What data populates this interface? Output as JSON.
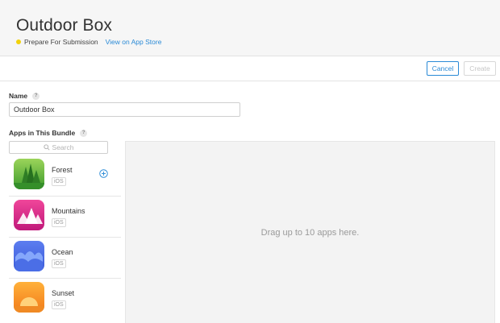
{
  "header": {
    "title": "Outdoor Box",
    "status": "Prepare For Submission",
    "status_color": "#f2d20c",
    "store_link": "View on App Store"
  },
  "toolbar": {
    "cancel_label": "Cancel",
    "create_label": "Create"
  },
  "form": {
    "name_label": "Name",
    "name_help": "?",
    "name_value": "Outdoor Box",
    "apps_label": "Apps in This Bundle",
    "apps_help": "?",
    "search_placeholder": "Search"
  },
  "apps": [
    {
      "name": "Forest",
      "platform": "iOS",
      "icon": "forest-icon"
    },
    {
      "name": "Mountains",
      "platform": "iOS",
      "icon": "mountains-icon"
    },
    {
      "name": "Ocean",
      "platform": "iOS",
      "icon": "ocean-icon"
    },
    {
      "name": "Sunset",
      "platform": "iOS",
      "icon": "sunset-icon"
    }
  ],
  "drop_zone": {
    "text": "Drag up to 10 apps here."
  },
  "colors": {
    "accent": "#2a8ad6"
  }
}
